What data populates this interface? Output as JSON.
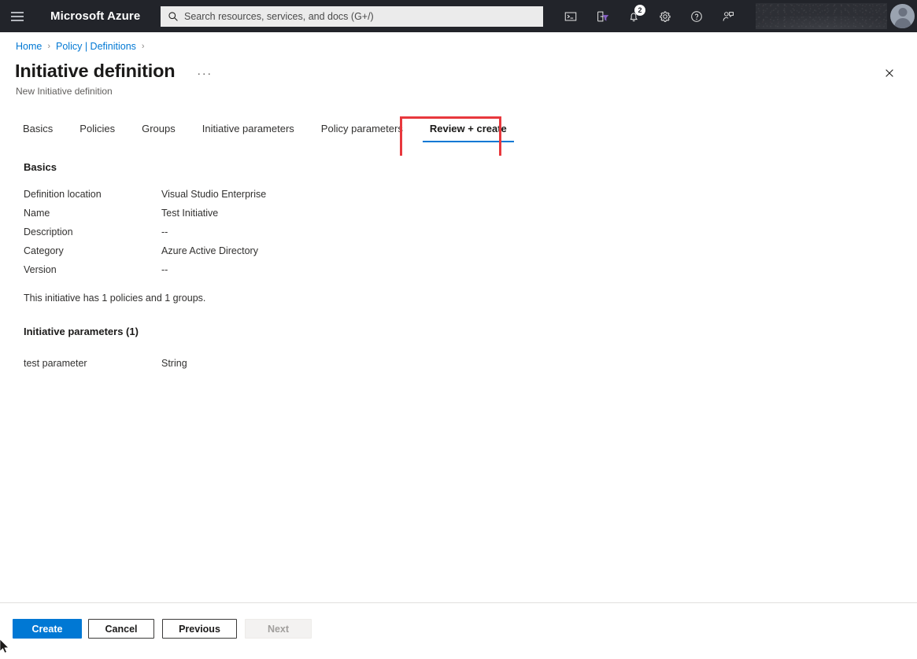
{
  "topbar": {
    "menu_icon": "hamburger-icon",
    "brand": "Microsoft Azure",
    "search": {
      "placeholder": "Search resources, services, and docs (G+/)",
      "value": "",
      "icon": "search-icon"
    },
    "icons": [
      {
        "name": "cloud-shell-icon",
        "label": "Cloud Shell"
      },
      {
        "name": "directory-filter-icon",
        "label": "Directories + subscriptions"
      },
      {
        "name": "notifications-bell-icon",
        "label": "Notifications",
        "badge": "2"
      },
      {
        "name": "settings-gear-icon",
        "label": "Settings"
      },
      {
        "name": "help-question-icon",
        "label": "Help"
      },
      {
        "name": "feedback-person-icon",
        "label": "Feedback"
      }
    ],
    "account_redacted": "",
    "avatar": "user-avatar"
  },
  "breadcrumb": {
    "items": [
      {
        "label": "Home"
      },
      {
        "label": "Policy | Definitions"
      }
    ],
    "separator": "›",
    "trailing_separator": "›"
  },
  "header": {
    "title": "Initiative definition",
    "ellipsis": "···",
    "subtitle": "New Initiative definition",
    "close_icon": "close-icon"
  },
  "tabs": [
    {
      "label": "Basics",
      "active": false
    },
    {
      "label": "Policies",
      "active": false
    },
    {
      "label": "Groups",
      "active": false
    },
    {
      "label": "Initiative parameters",
      "active": false
    },
    {
      "label": "Policy parameters",
      "active": false
    },
    {
      "label": "Review + create",
      "active": true
    }
  ],
  "annotation": {
    "target_tab": "Review + create",
    "color": "#e8383d"
  },
  "main": {
    "basics_heading": "Basics",
    "basics_rows": [
      {
        "key": "Definition location",
        "value": "Visual Studio Enterprise"
      },
      {
        "key": "Name",
        "value": "Test Initiative"
      },
      {
        "key": "Description",
        "value": "--"
      },
      {
        "key": "Category",
        "value": "Azure Active Directory"
      },
      {
        "key": "Version",
        "value": "--"
      }
    ],
    "summary_note": "This initiative has 1 policies and 1 groups.",
    "parameters_heading": "Initiative parameters (1)",
    "parameter_rows": [
      {
        "key": "test parameter",
        "value": "String"
      }
    ]
  },
  "footer": {
    "buttons": [
      {
        "label": "Create",
        "style": "primary",
        "disabled": false
      },
      {
        "label": "Cancel",
        "style": "secondary",
        "disabled": false
      },
      {
        "label": "Previous",
        "style": "secondary",
        "disabled": false
      },
      {
        "label": "Next",
        "style": "disabled",
        "disabled": true
      }
    ]
  },
  "theme": {
    "accent": "#0078d4",
    "topbar_bg": "#22242a",
    "annotation_red": "#e8383d"
  }
}
